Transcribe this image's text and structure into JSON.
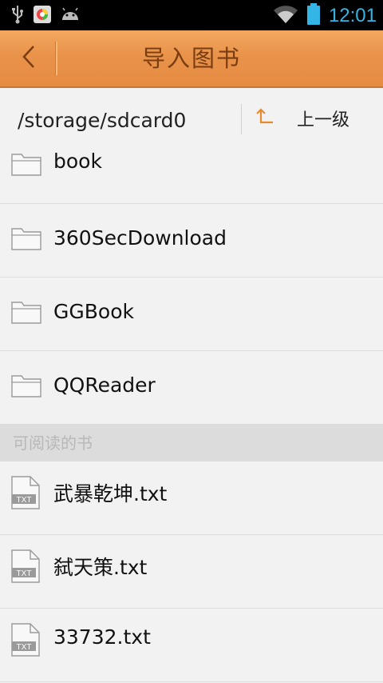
{
  "status_bar": {
    "time": "12:01",
    "icons": [
      "usb-icon",
      "app-notification-icon",
      "android-icon",
      "wifi-icon",
      "battery-icon"
    ],
    "accent_color": "#33b5e5"
  },
  "title_bar": {
    "title": "导入图书",
    "back_icon": "chevron-left-icon",
    "background_color": "#e9924a",
    "title_color": "#7a3d12"
  },
  "path_bar": {
    "path": "/storage/sdcard0",
    "up_label": "上一级",
    "up_icon": "arrow-up-icon",
    "up_icon_color": "#e58a2e"
  },
  "folders": [
    {
      "name": "book"
    },
    {
      "name": "360SecDownload"
    },
    {
      "name": "GGBook"
    },
    {
      "name": "QQReader"
    }
  ],
  "readable_section": {
    "header": "可阅读的书",
    "files": [
      {
        "name": "武暴乾坤.txt",
        "badge": "TXT"
      },
      {
        "name": "弑天策.txt",
        "badge": "TXT"
      },
      {
        "name": "33732.txt",
        "badge": "TXT"
      }
    ]
  }
}
